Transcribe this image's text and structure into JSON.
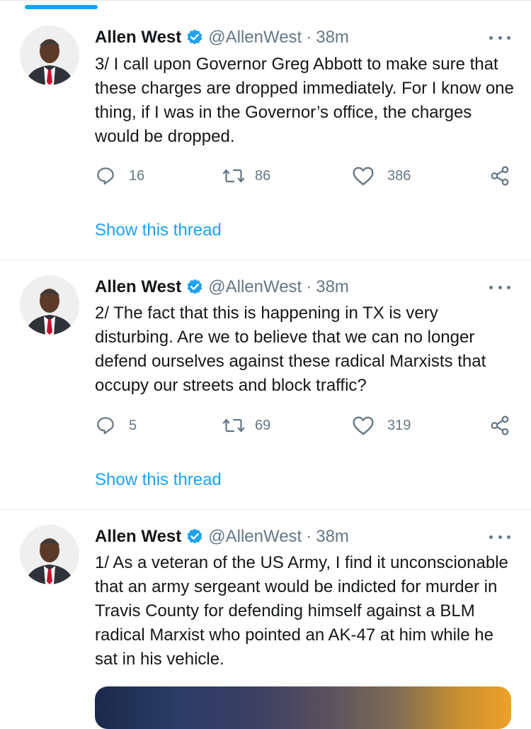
{
  "colors": {
    "accent": "#1da1f2",
    "secondary_text": "#657786",
    "primary_text": "#14171a",
    "divider": "#e6ecf0"
  },
  "tweets": [
    {
      "name": "Allen West",
      "handle": "@AllenWest",
      "separator": "·",
      "time": "38m",
      "text": "3/ I call upon Governor Greg Abbott to make sure that these charges are dropped immediately. For I know one thing, if I was in the Governor’s office, the charges would be dropped.",
      "replies": "16",
      "retweets": "86",
      "likes": "386",
      "show_thread": "Show this thread",
      "icons": [
        "verified-icon",
        "reply-icon",
        "retweet-icon",
        "like-icon",
        "share-icon",
        "more-icon"
      ]
    },
    {
      "name": "Allen West",
      "handle": "@AllenWest",
      "separator": "·",
      "time": "38m",
      "text": "2/ The fact that this is happening in TX is very disturbing. Are we to believe that we can no longer defend ourselves against these radical Marxists that occupy our streets and block traffic?",
      "replies": "5",
      "retweets": "69",
      "likes": "319",
      "show_thread": "Show this thread",
      "icons": [
        "verified-icon",
        "reply-icon",
        "retweet-icon",
        "like-icon",
        "share-icon",
        "more-icon"
      ]
    },
    {
      "name": "Allen West",
      "handle": "@AllenWest",
      "separator": "·",
      "time": "38m",
      "text": "1/ As a veteran of the US Army, I find it unconscionable that an army sergeant would be indicted for murder in Travis County for defending himself against a BLM radical Marxist who pointed an AK-47 at him while he sat in his vehicle.",
      "icons": [
        "verified-icon",
        "more-icon"
      ]
    }
  ]
}
